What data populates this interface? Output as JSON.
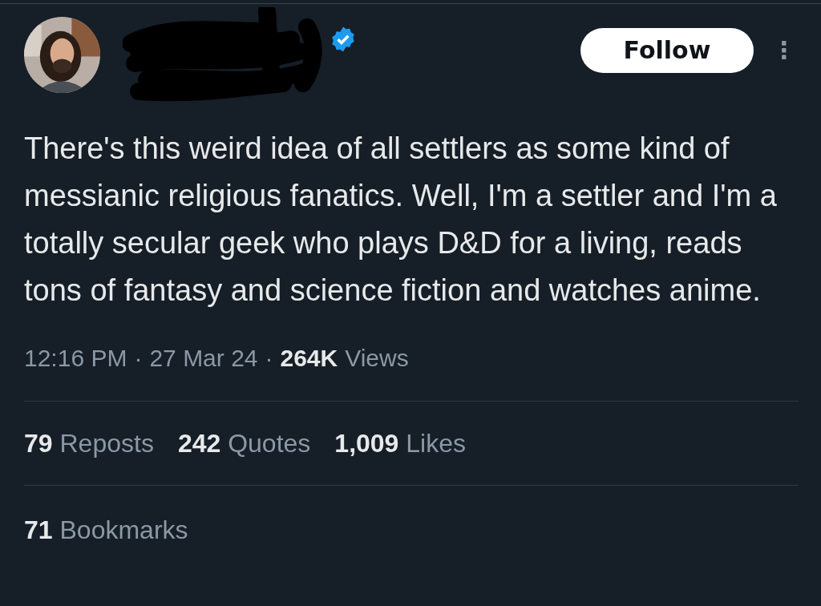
{
  "author": {
    "verified": true
  },
  "follow_button": "Follow",
  "more_menu": "⋮",
  "text": "There's this weird idea of all settlers as some kind of messianic religious fanatics. Well, I'm a settler and I'm a totally secular geek who plays D&D for a living, reads tons of fantasy and science fiction and watches anime.",
  "meta": {
    "time": "12:16 PM",
    "separator_1": "·",
    "date": "27 Mar 24",
    "separator_2": "·",
    "views_count": "264K",
    "views_label": "Views"
  },
  "stats": [
    {
      "count": "79",
      "label": "Reposts"
    },
    {
      "count": "242",
      "label": "Quotes"
    },
    {
      "count": "1,009",
      "label": "Likes"
    }
  ],
  "bookmarks": {
    "count": "71",
    "label": "Bookmarks"
  }
}
